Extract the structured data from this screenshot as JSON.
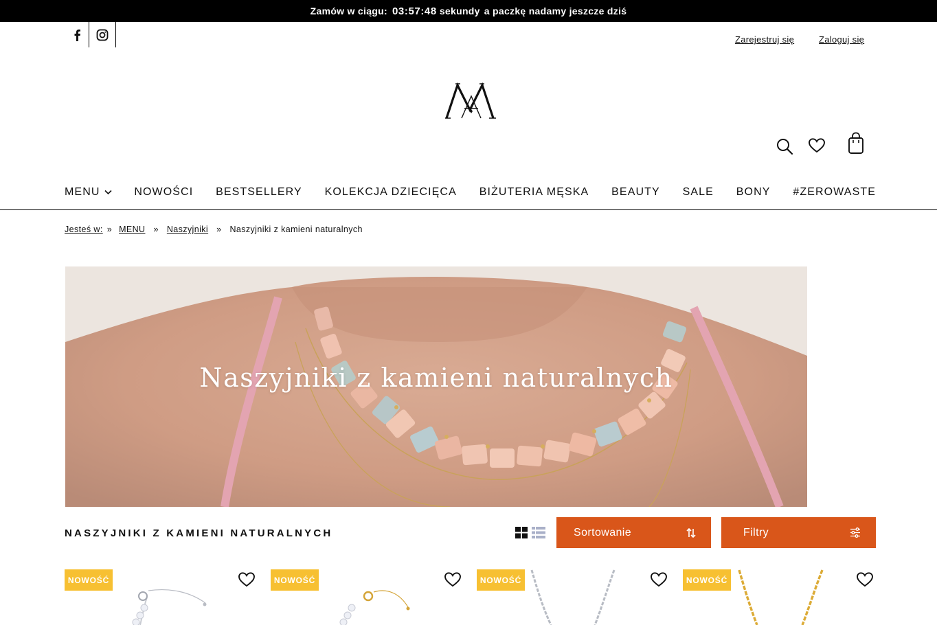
{
  "promo": {
    "before": "Zamów w ciągu:",
    "timer": "03:57:48",
    "unit": "sekundy",
    "after": "a paczkę nadamy jeszcze dziś"
  },
  "account": {
    "register": "Zarejestruj się",
    "login": "Zaloguj się"
  },
  "nav": {
    "items": [
      "MENU",
      "NOWOŚCI",
      "BESTSELLERY",
      "KOLEKCJA DZIECIĘCA",
      "BIŻUTERIA MĘSKA",
      "BEAUTY",
      "SALE",
      "BONY",
      "#ZEROWASTE"
    ]
  },
  "breadcrumb": {
    "prefix": "Jesteś w:",
    "items": [
      "MENU",
      "Naszyjniki",
      "Naszyjniki z kamieni naturalnych"
    ]
  },
  "hero": {
    "title": "Naszyjniki z kamieni naturalnych"
  },
  "toolbar": {
    "category_title": "NASZYJNIKI Z KAMIENI NATURALNYCH",
    "sort_label": "Sortowanie",
    "filter_label": "Filtry"
  },
  "products": [
    {
      "badge": "NOWOŚĆ"
    },
    {
      "badge": "NOWOŚĆ"
    },
    {
      "badge": "NOWOŚĆ"
    },
    {
      "badge": "NOWOŚĆ"
    }
  ],
  "colors": {
    "accent": "#d9561a",
    "badge": "#f7c032",
    "promo_bar": "#000000"
  }
}
